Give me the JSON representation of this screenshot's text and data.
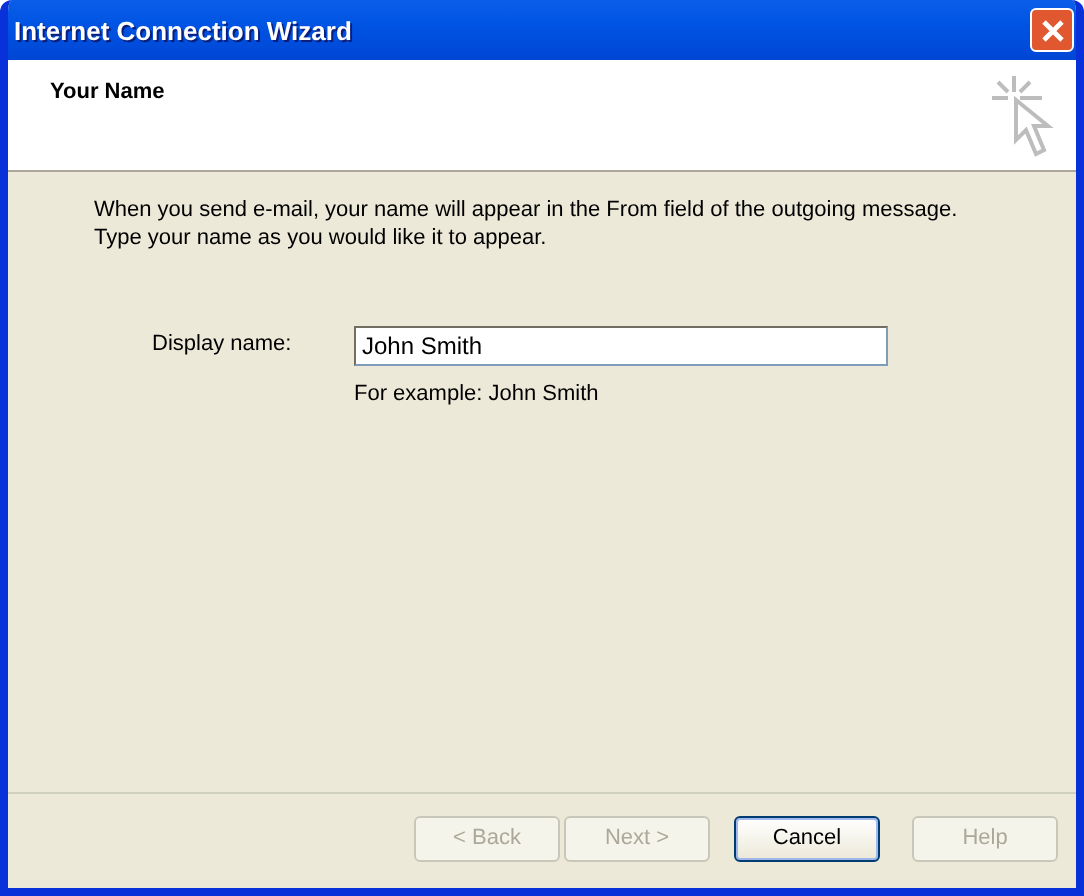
{
  "window": {
    "title": "Internet Connection Wizard"
  },
  "header": {
    "title": "Your Name"
  },
  "description": "When you send e-mail, your name will appear in the From field of the outgoing message.\nType your name as you would like it to appear.",
  "display_name": {
    "label": "Display name:",
    "value": "John Smith",
    "hint": "For example: John Smith"
  },
  "buttons": [
    {
      "label": "< Back",
      "disabled": true,
      "default": false
    },
    {
      "label": "Next >",
      "disabled": true,
      "default": false
    },
    {
      "label": "Cancel",
      "disabled": false,
      "default": true
    },
    {
      "label": "Help",
      "disabled": true,
      "default": false
    }
  ]
}
